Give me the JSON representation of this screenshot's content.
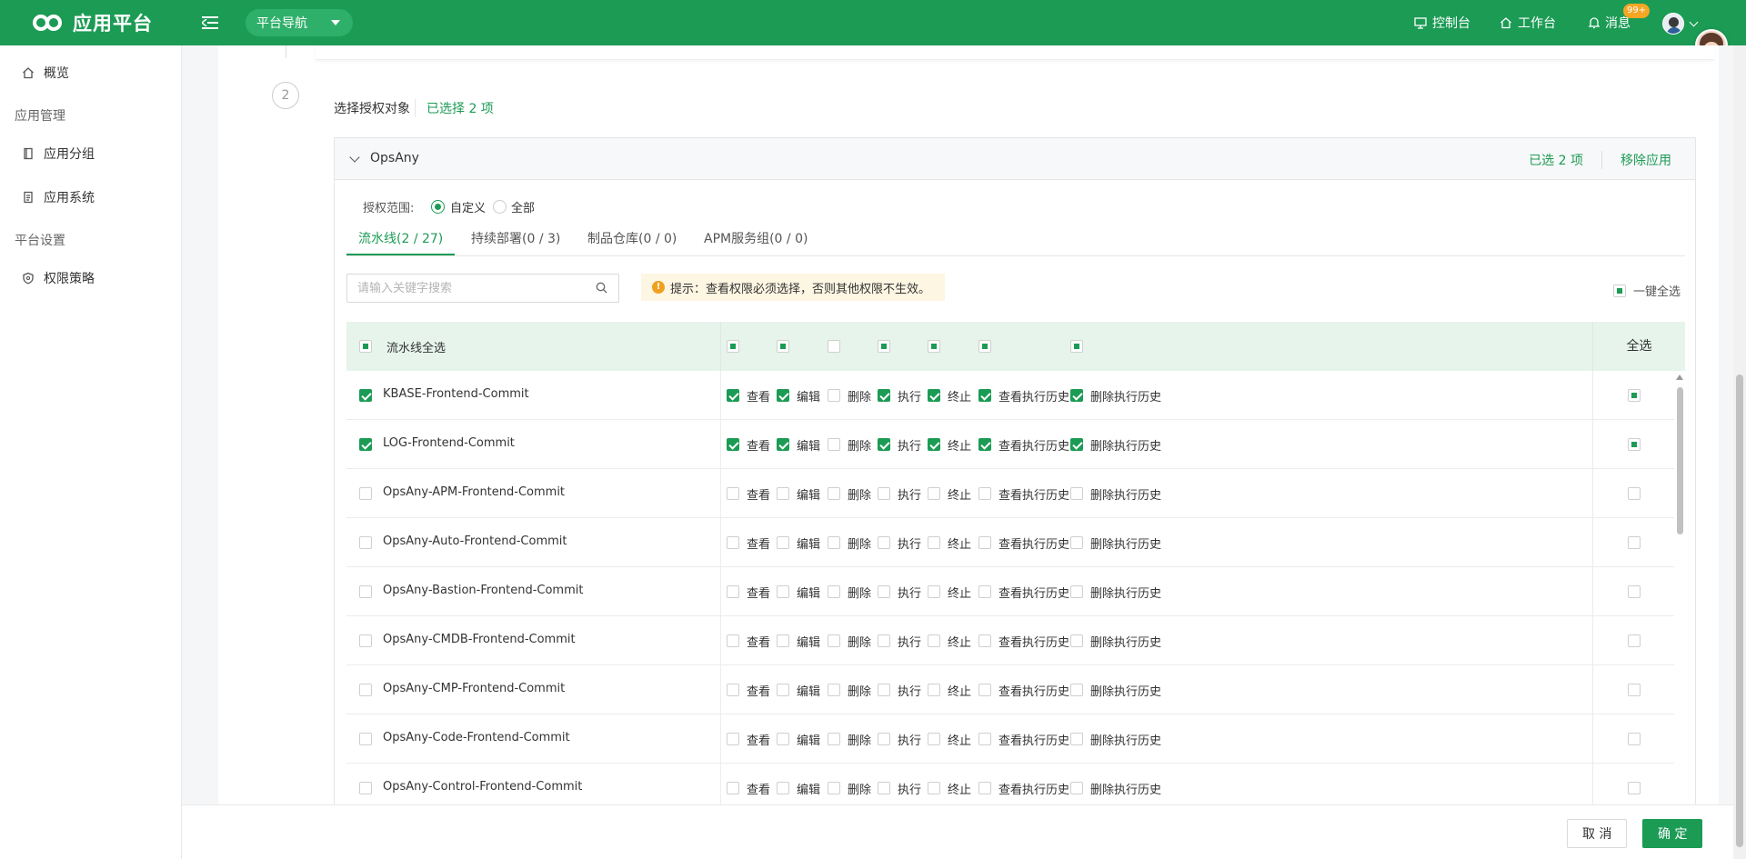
{
  "app": {
    "title": "应用平台"
  },
  "topbar": {
    "nav_pill": "平台导航",
    "items": [
      {
        "icon": "monitor-icon",
        "label": "控制台"
      },
      {
        "icon": "home-icon",
        "label": "工作台"
      },
      {
        "icon": "bell-icon",
        "label": "消息"
      }
    ],
    "badge": "99+"
  },
  "sidebar": {
    "overview": "概览",
    "groups": [
      {
        "label": "应用管理",
        "items": [
          {
            "icon": "book-icon",
            "label": "应用分组"
          },
          {
            "icon": "file-list-icon",
            "label": "应用系统"
          }
        ]
      },
      {
        "label": "平台设置",
        "items": [
          {
            "icon": "shield-icon",
            "label": "权限策略"
          }
        ]
      }
    ]
  },
  "step": {
    "number": "2",
    "title": "选择授权对象",
    "selected": "已选择 2 项"
  },
  "app_box": {
    "name": "OpsAny",
    "selected_count": "已选 2 项",
    "remove": "移除应用",
    "scope_label": "授权范围:",
    "scope_options": [
      {
        "label": "自定义",
        "selected": true
      },
      {
        "label": "全部",
        "selected": false
      }
    ],
    "tabs": [
      "流水线(2 / 27)",
      "持续部署(0 / 3)",
      "制品仓库(0 / 0)",
      "APM服务组(0 / 0)"
    ],
    "active_tab": 0,
    "search_placeholder": "请输入关键字搜索",
    "tip": "提示：查看权限必须选择，否则其他权限不生效。",
    "one_key_select_all": "一键全选"
  },
  "table": {
    "header_select_all": "流水线全选",
    "header_last": "全选",
    "header_perm_states": [
      "partial",
      "partial",
      "none",
      "partial",
      "partial",
      "partial",
      "partial"
    ],
    "permissions": [
      "查看",
      "编辑",
      "删除",
      "执行",
      "终止",
      "查看执行历史",
      "删除执行历史"
    ],
    "rows": [
      {
        "name": "KBASE-Frontend-Commit",
        "checked": true,
        "perms": [
          true,
          true,
          false,
          true,
          true,
          true,
          true
        ],
        "all": "partial"
      },
      {
        "name": "LOG-Frontend-Commit",
        "checked": true,
        "perms": [
          true,
          true,
          false,
          true,
          true,
          true,
          true
        ],
        "all": "partial"
      },
      {
        "name": "OpsAny-APM-Frontend-Commit",
        "checked": false,
        "perms": [
          false,
          false,
          false,
          false,
          false,
          false,
          false
        ],
        "all": "none"
      },
      {
        "name": "OpsAny-Auto-Frontend-Commit",
        "checked": false,
        "perms": [
          false,
          false,
          false,
          false,
          false,
          false,
          false
        ],
        "all": "none"
      },
      {
        "name": "OpsAny-Bastion-Frontend-Commit",
        "checked": false,
        "perms": [
          false,
          false,
          false,
          false,
          false,
          false,
          false
        ],
        "all": "none"
      },
      {
        "name": "OpsAny-CMDB-Frontend-Commit",
        "checked": false,
        "perms": [
          false,
          false,
          false,
          false,
          false,
          false,
          false
        ],
        "all": "none"
      },
      {
        "name": "OpsAny-CMP-Frontend-Commit",
        "checked": false,
        "perms": [
          false,
          false,
          false,
          false,
          false,
          false,
          false
        ],
        "all": "none"
      },
      {
        "name": "OpsAny-Code-Frontend-Commit",
        "checked": false,
        "perms": [
          false,
          false,
          false,
          false,
          false,
          false,
          false
        ],
        "all": "none"
      },
      {
        "name": "OpsAny-Control-Frontend-Commit",
        "checked": false,
        "perms": [
          false,
          false,
          false,
          false,
          false,
          false,
          false
        ],
        "all": "none"
      }
    ]
  },
  "footer": {
    "cancel": "取 消",
    "confirm": "确 定"
  },
  "colors": {
    "brand": "#1c9b55",
    "tip_bg": "#fdf6e3",
    "header_row": "#e6f4ec"
  }
}
